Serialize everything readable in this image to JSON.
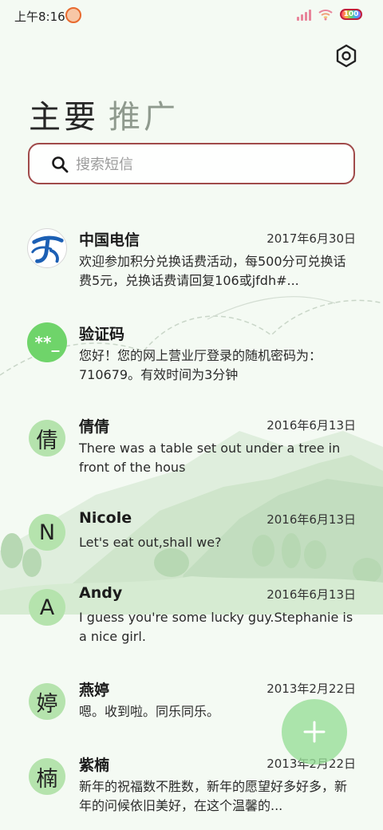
{
  "status_bar": {
    "time": "上午8:16",
    "battery": "100"
  },
  "header": {
    "settings_icon": "hexagon-settings-icon",
    "tabs": [
      {
        "label": "主要",
        "active": true
      },
      {
        "label": "推广",
        "active": false
      }
    ]
  },
  "search": {
    "placeholder": "搜索短信",
    "value": ""
  },
  "messages": [
    {
      "sender": "中国电信",
      "date": "2017年6月30日",
      "preview": "欢迎参加积分兑换话费活动，每500分可兑换话费5元，兑换话费请回复106或jfdh#..."
    },
    {
      "sender": "验证码",
      "date": "",
      "avatar_text": "**_",
      "preview": "您好！您的网上营业厅登录的随机密码为：710679。有效时间为3分钟"
    },
    {
      "sender": "倩倩",
      "date": "2016年6月13日",
      "avatar_text": "倩",
      "preview": "There was a table set out under a tree in front of the hous"
    },
    {
      "sender": "Nicole",
      "date": "2016年6月13日",
      "avatar_text": "N",
      "preview": "Let's eat out,shall we?"
    },
    {
      "sender": "Andy",
      "date": "2016年6月13日",
      "avatar_text": "A",
      "preview": "I guess you're some lucky guy.Stephanie is a nice girl."
    },
    {
      "sender": "燕婷",
      "date": "2013年2月22日",
      "avatar_text": "婷",
      "preview": "嗯。收到啦。同乐同乐。"
    },
    {
      "sender": "紫楠",
      "date": "2013年2月22日",
      "avatar_text": "楠",
      "preview": "新年的祝福数不胜数，新年的愿望好多好多，新年的问候依旧美好，在这个温馨的..."
    }
  ],
  "fab": {
    "icon": "plus-icon"
  },
  "colors": {
    "background": "#f4faf3",
    "search_border": "#a04a4a",
    "avatar_green": "#b5e3ad",
    "code_avatar": "#6fd46a",
    "fab": "#96de96"
  }
}
